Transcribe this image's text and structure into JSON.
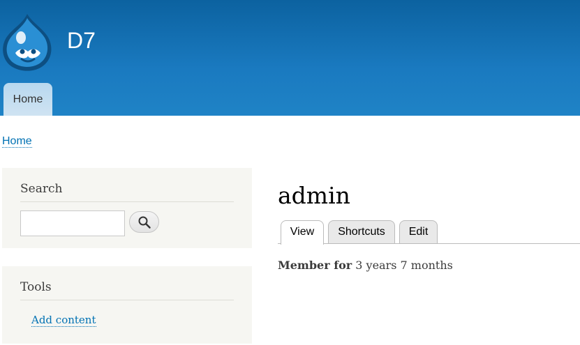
{
  "header": {
    "site_name": "D7",
    "nav": [
      {
        "label": "Home"
      }
    ]
  },
  "breadcrumb": [
    "Home"
  ],
  "sidebar": {
    "search_block": {
      "title": "Search",
      "input_value": "",
      "button_icon": "search-icon"
    },
    "tools_block": {
      "title": "Tools",
      "links": [
        {
          "label": "Add content"
        }
      ]
    }
  },
  "main": {
    "page_title": "admin",
    "tabs": [
      {
        "label": "View",
        "active": true
      },
      {
        "label": "Shortcuts",
        "active": false
      },
      {
        "label": "Edit",
        "active": false
      }
    ],
    "member_label": "Member for",
    "member_value": "3 years 7 months"
  },
  "colors": {
    "header_top": "#0c62a0",
    "header_bottom": "#1f83c6",
    "link": "#0071b3",
    "sidebar_bg": "#f6f6f2"
  }
}
